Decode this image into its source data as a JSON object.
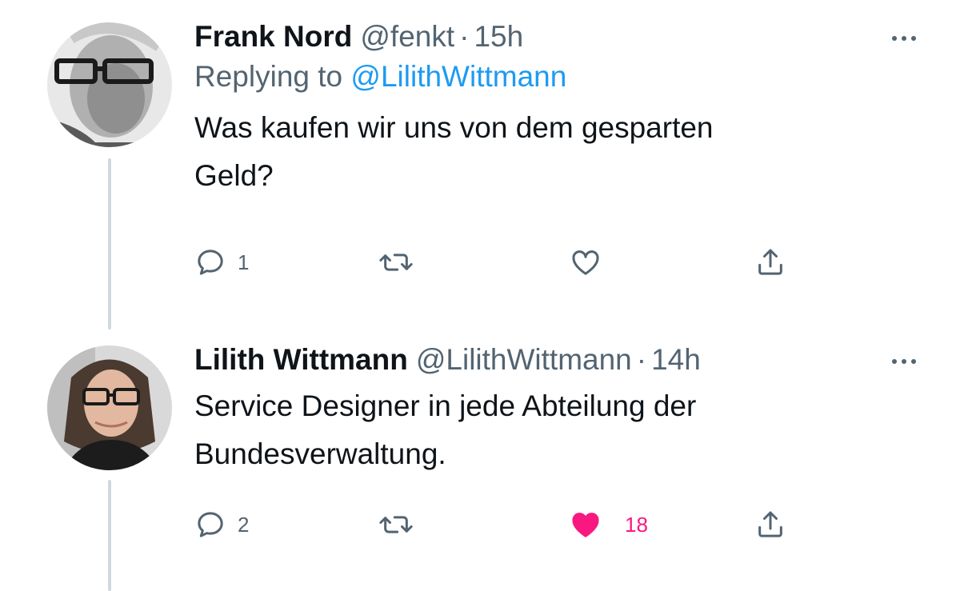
{
  "tweets": [
    {
      "name": "Frank Nord",
      "handle": "@fenkt",
      "dot": "·",
      "time": "15h",
      "reply_prefix": "Replying to ",
      "reply_mention": "@LilithWittmann",
      "text": "Was kaufen wir uns von dem gesparten\nGeld?",
      "actions": {
        "reply_count": "1",
        "retweet_count": "",
        "like_count": "",
        "liked": false
      }
    },
    {
      "name": "Lilith Wittmann",
      "handle": "@LilithWittmann",
      "dot": "·",
      "time": "14h",
      "text": "Service Designer in jede Abteilung der\nBundesverwaltung.",
      "actions": {
        "reply_count": "2",
        "retweet_count": "",
        "like_count": "18",
        "liked": true
      }
    }
  ],
  "icons": {
    "reply": "speech-bubble-icon",
    "retweet": "retweet-icon",
    "like": "heart-icon",
    "share": "share-upload-icon",
    "more": "more-dots-icon"
  },
  "colors": {
    "text": "#0f1419",
    "secondary": "#536471",
    "link": "#1d9bf0",
    "like": "#f91880",
    "thread_line": "#cfd9de"
  }
}
